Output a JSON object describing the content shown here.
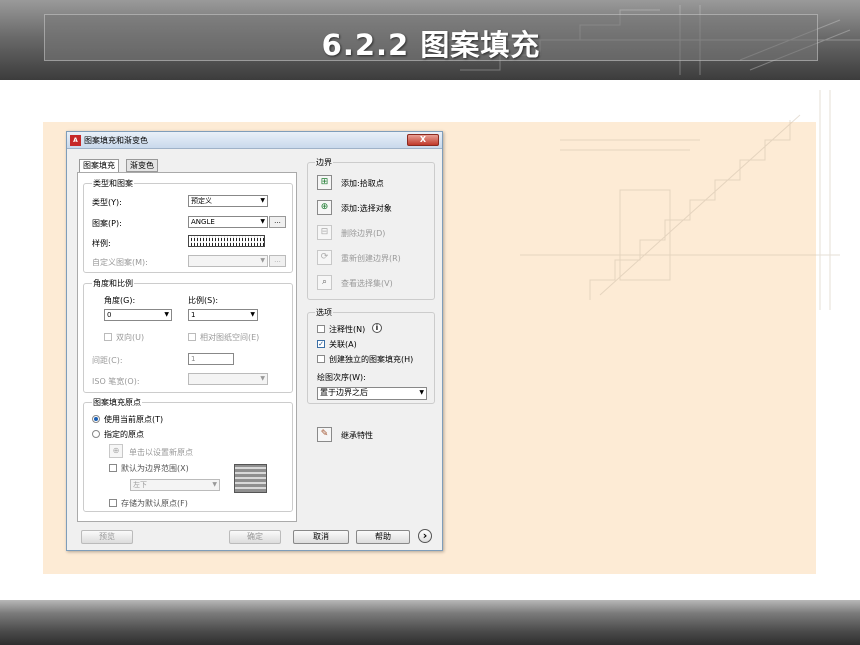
{
  "slide_title": "6.2.2  图案填充",
  "dialog": {
    "app_icon_label": "A",
    "title": "图案填充和渐变色",
    "close_label": "X",
    "tabs": [
      "图案填充",
      "渐变色"
    ],
    "type_pattern": {
      "group_title": "类型和图案",
      "type_label": "类型(Y):",
      "type_value": "预定义",
      "pattern_label": "图案(P):",
      "pattern_value": "ANGLE",
      "browse_label": "...",
      "sample_label": "样例:",
      "custom_label": "自定义图案(M):",
      "custom_value": ""
    },
    "angle_scale": {
      "group_title": "角度和比例",
      "angle_label": "角度(G):",
      "angle_value": "0",
      "scale_label": "比例(S):",
      "scale_value": "1",
      "double_label": "双向(U)",
      "relative_label": "相对图纸空间(E)",
      "spacing_label": "间距(C):",
      "spacing_value": "1",
      "iso_label": "ISO 笔宽(O):",
      "iso_value": ""
    },
    "origin": {
      "group_title": "图案填充原点",
      "use_current_label": "使用当前原点(T)",
      "specified_label": "指定的原点",
      "click_set_label": "单击以设置新原点",
      "default_extent_label": "默认为边界范围(X)",
      "position_value": "左下",
      "store_default_label": "存储为默认原点(F)"
    },
    "boundaries": {
      "group_title": "边界",
      "add_pick": "添加:拾取点",
      "add_select": "添加:选择对象",
      "remove": "删除边界(D)",
      "recreate": "重新创建边界(R)",
      "view_selections": "查看选择集(V)"
    },
    "options": {
      "group_title": "选项",
      "annotative_label": "注释性(N)",
      "info_icon": "i",
      "associative_label": "关联(A)",
      "associative_checked": true,
      "separate_label": "创建独立的图案填充(H)",
      "draw_order_label": "绘图次序(W):",
      "draw_order_value": "置于边界之后"
    },
    "inherit_label": "继承特性",
    "footer": {
      "preview": "预览",
      "ok": "确定",
      "cancel": "取消",
      "help": "帮助",
      "more_icon": "›"
    }
  }
}
